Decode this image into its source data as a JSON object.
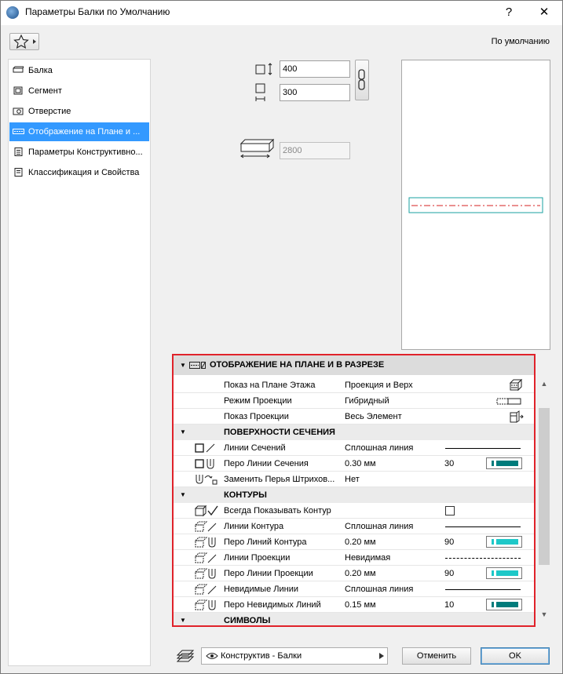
{
  "window": {
    "title": "Параметры Балки по Умолчанию",
    "help_label": "?",
    "close_label": "✕"
  },
  "header": {
    "default_label": "По умолчанию"
  },
  "nav": {
    "items": [
      {
        "label": "Балка"
      },
      {
        "label": "Сегмент"
      },
      {
        "label": "Отверстие"
      },
      {
        "label": "Отображение на Плане и ..."
      },
      {
        "label": "Параметры Конструктивно..."
      },
      {
        "label": "Классификация и Свойства"
      }
    ],
    "selected_index": 3
  },
  "geometry": {
    "height_value": "400",
    "width_value": "300",
    "length_value": "2800"
  },
  "section": {
    "title": "ОТОБРАЖЕНИЕ НА ПЛАНЕ И В РАЗРЕЗЕ",
    "rows": [
      {
        "name": "Показ на Плане Этажа",
        "value": "Проекция и Верх"
      },
      {
        "name": "Режим Проекции",
        "value": "Гибридный"
      },
      {
        "name": "Показ Проекции",
        "value": "Весь Элемент"
      }
    ],
    "cut": {
      "title": "ПОВЕРХНОСТИ СЕЧЕНИЯ",
      "lines_label": "Линии Сечений",
      "lines_value": "Сплошная линия",
      "pen_label": "Перо Линии Сечения",
      "pen_value": "0.30 мм",
      "pen_number": "30",
      "override_label": "Заменить Перья Штрихов...",
      "override_value": "Нет"
    },
    "outlines": {
      "title": "КОНТУРЫ",
      "always_label": "Всегда Показывать Контур",
      "contour_lines_label": "Линии Контура",
      "contour_lines_value": "Сплошная линия",
      "contour_pen_label": "Перо Линий Контура",
      "contour_pen_value": "0.20 мм",
      "contour_pen_number": "90",
      "proj_lines_label": "Линии Проекции",
      "proj_lines_value": "Невидимая",
      "proj_pen_label": "Перо Линии Проекции",
      "proj_pen_value": "0.20 мм",
      "proj_pen_number": "90",
      "hidden_lines_label": "Невидимые Линии",
      "hidden_lines_value": "Сплошная линия",
      "hidden_pen_label": "Перо Невидимых Линий",
      "hidden_pen_value": "0.15 мм",
      "hidden_pen_number": "10"
    },
    "symbols": {
      "title": "СИМВОЛЫ"
    }
  },
  "colors": {
    "pen_dark": "#007b7b",
    "pen_light": "#1ec8c8",
    "highlight": "#e0222a",
    "selection": "#3399ff"
  },
  "footer": {
    "view_label": "Конструктив - Балки",
    "cancel_label": "Отменить",
    "ok_label": "OK"
  }
}
